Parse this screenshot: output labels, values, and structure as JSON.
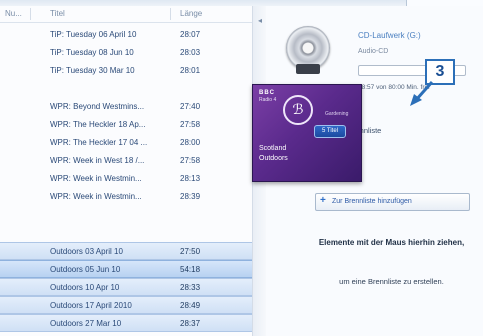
{
  "list": {
    "headers": {
      "num": "Nu...",
      "title": "Titel",
      "length": "Länge"
    },
    "rows": [
      {
        "title": "TiP: Tuesday 06 April 10",
        "length": "28:07",
        "selected": false
      },
      {
        "title": "TiP: Tuesday 08 Jun 10",
        "length": "28:03",
        "selected": false
      },
      {
        "title": "TiP: Tuesday 30 Mar 10",
        "length": "28:01",
        "selected": false
      },
      {
        "title": "",
        "length": "",
        "selected": false
      },
      {
        "title": "WPR: Beyond Westmins...",
        "length": "27:40",
        "selected": false
      },
      {
        "title": "WPR: The Heckler 18 Ap...",
        "length": "27:58",
        "selected": false
      },
      {
        "title": "WPR: The Heckler 17 04 ...",
        "length": "28:00",
        "selected": false
      },
      {
        "title": "WPR: Week in West 18 /...",
        "length": "27:58",
        "selected": false
      },
      {
        "title": "WPR: Week in Westmin...",
        "length": "28:13",
        "selected": false
      },
      {
        "title": "WPR: Week in Westmin...",
        "length": "28:39",
        "selected": false
      },
      {
        "title": "",
        "length": "",
        "selected": false
      },
      {
        "title": "",
        "length": "",
        "selected": false
      },
      {
        "title": "Outdoors 03 April 10",
        "length": "27:50",
        "selected": true
      },
      {
        "title": "Outdoors 05 Jun 10",
        "length": "54:18",
        "selected": true,
        "active": true
      },
      {
        "title": "Outdoors 10 Apr 10",
        "length": "28:33",
        "selected": true
      },
      {
        "title": "Outdoors 17 April 2010",
        "length": "28:49",
        "selected": true
      },
      {
        "title": "Outdoors 27 Mar 10",
        "length": "28:37",
        "selected": true
      }
    ]
  },
  "drive": {
    "title": "CD-Laufwerk (G:)",
    "subtitle": "Audio-CD",
    "progress_fraction": 0,
    "free_text": "78:57 von 80:00 Min. frei"
  },
  "burn": {
    "list_label": "Brennliste",
    "add_button_label": "Zur Brennliste hinzufügen",
    "drop_hint_bold": "Elemente mit der Maus hierhin ziehen,",
    "drop_hint": "um eine Brennliste zu erstellen."
  },
  "album": {
    "brand": "BBC",
    "station": "Radio 4",
    "gen_text": "Gardening",
    "badge": "5 Titel",
    "name_line1": "Scotland",
    "name_line2": "Outdoors"
  },
  "callout": {
    "number": "3"
  },
  "colors": {
    "accent": "#2c6fb8",
    "selection": "#cfe0f5",
    "album": "#5a2a8c"
  }
}
